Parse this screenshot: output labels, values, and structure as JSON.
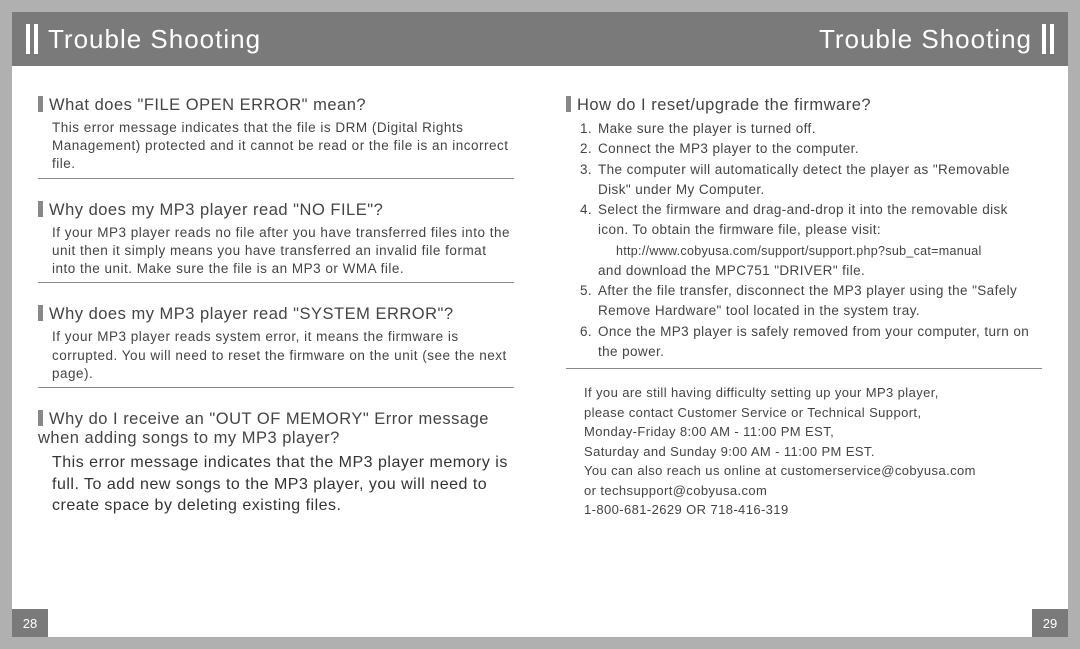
{
  "header": {
    "left_title": "Trouble Shooting",
    "right_title": "Trouble Shooting"
  },
  "left_page": {
    "q1": "What does \"FILE OPEN ERROR\" mean?",
    "a1": "This error message indicates that the file is DRM (Digital Rights Management) protected and it cannot be read or the file is an incorrect file.",
    "q2": "Why does my MP3 player read \"NO FILE\"?",
    "a2": "If your MP3 player reads no file after you have transferred files into the unit then it simply means you have transferred an invalid file format into the unit. Make sure the file is an MP3 or WMA file.",
    "q3": "Why does my MP3 player read \"SYSTEM ERROR\"?",
    "a3": "If your MP3 player reads system error, it means the firmware is corrupted. You will need to reset the firmware on the unit (see the next page).",
    "q4": "Why do I receive an \"OUT OF MEMORY\" Error message when adding songs to my MP3 player?",
    "a4": "This error message indicates that the MP3 player memory is full. To add new songs to the MP3 player, you will need to create space by deleting existing files.",
    "page_num": "28"
  },
  "right_page": {
    "q1": "How do I reset/upgrade the firmware?",
    "steps": {
      "s1": "Make sure the player is turned off.",
      "s2": "Connect the MP3 player to the computer.",
      "s3": "The computer will automatically detect the player as \"Removable Disk\" under My Computer.",
      "s4": "Select the firmware and drag-and-drop it into the removable disk icon. To obtain the firmware file, please visit:",
      "s4url": "http://www.cobyusa.com/support/support.php?sub_cat=manual",
      "s4b": "and download the MPC751 \"DRIVER\" file.",
      "s5": "After the file transfer, disconnect the MP3 player using the \"Safely Remove Hardware\" tool located in the system tray.",
      "s6": "Once the MP3 player is safely removed from your computer, turn on the power."
    },
    "support": {
      "l1": "If you are still having difficulty setting up your MP3 player,",
      "l2": "please contact Customer Service or Technical Support,",
      "l3": "Monday-Friday 8:00 AM - 11:00 PM EST,",
      "l4": "Saturday and Sunday 9:00 AM - 11:00 PM EST.",
      "l5": "You can also reach us online at customerservice@cobyusa.com",
      "l6": "or techsupport@cobyusa.com",
      "l7": "1-800-681-2629 OR 718-416-319"
    },
    "page_num": "29"
  }
}
